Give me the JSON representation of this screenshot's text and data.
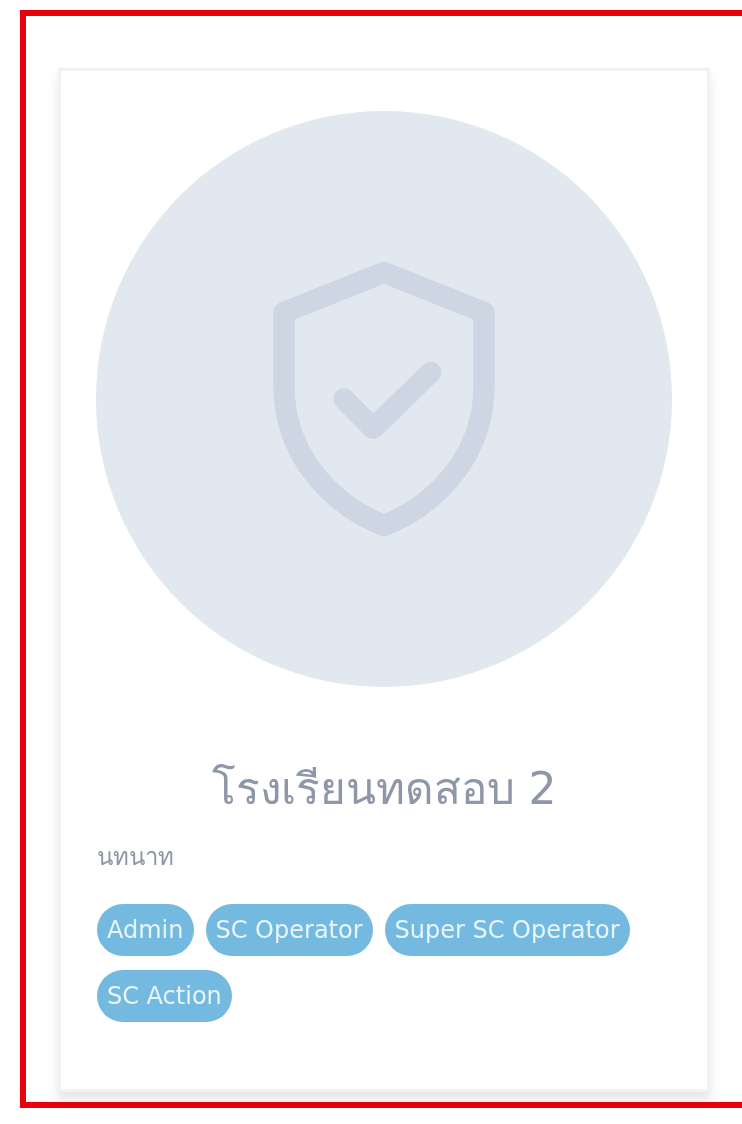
{
  "card": {
    "title": "โรงเรียนทดสอบ 2",
    "subtitle": "นทนาท",
    "roles": [
      "Admin",
      "SC Operator",
      "Super SC Operator",
      "SC Action"
    ]
  }
}
